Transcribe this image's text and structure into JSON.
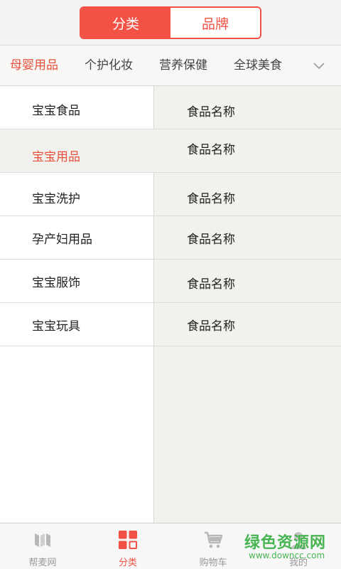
{
  "segment": {
    "active_label": "分类",
    "inactive_label": "品牌"
  },
  "category_tabs": [
    {
      "label": "母婴用品",
      "active": true
    },
    {
      "label": "个护化妆",
      "active": false
    },
    {
      "label": "营养保健",
      "active": false
    },
    {
      "label": "全球美食",
      "active": false
    }
  ],
  "left_menu": [
    {
      "label": "宝宝食品"
    },
    {
      "label": "宝宝用品",
      "active": true
    },
    {
      "label": "宝宝洗护"
    },
    {
      "label": "孕产妇用品"
    },
    {
      "label": "宝宝服饰"
    },
    {
      "label": "宝宝玩具"
    }
  ],
  "right_list": [
    {
      "label": "食品名称"
    },
    {
      "label": "食品名称"
    },
    {
      "label": "食品名称"
    },
    {
      "label": "食品名称"
    },
    {
      "label": "食品名称"
    },
    {
      "label": "食品名称"
    }
  ],
  "tabbar": [
    {
      "label": "帮麦网",
      "icon": "bangmai-logo-icon"
    },
    {
      "label": "分类",
      "icon": "grid-icon",
      "active": true
    },
    {
      "label": "购物车",
      "icon": "cart-icon"
    },
    {
      "label": "我的",
      "icon": "user-icon"
    }
  ],
  "watermark": {
    "text": "绿色资源网",
    "url": "www.downcc.com"
  },
  "colors": {
    "accent": "#f25246",
    "active_text": "#e9503e",
    "watermark": "#3fb24a"
  }
}
